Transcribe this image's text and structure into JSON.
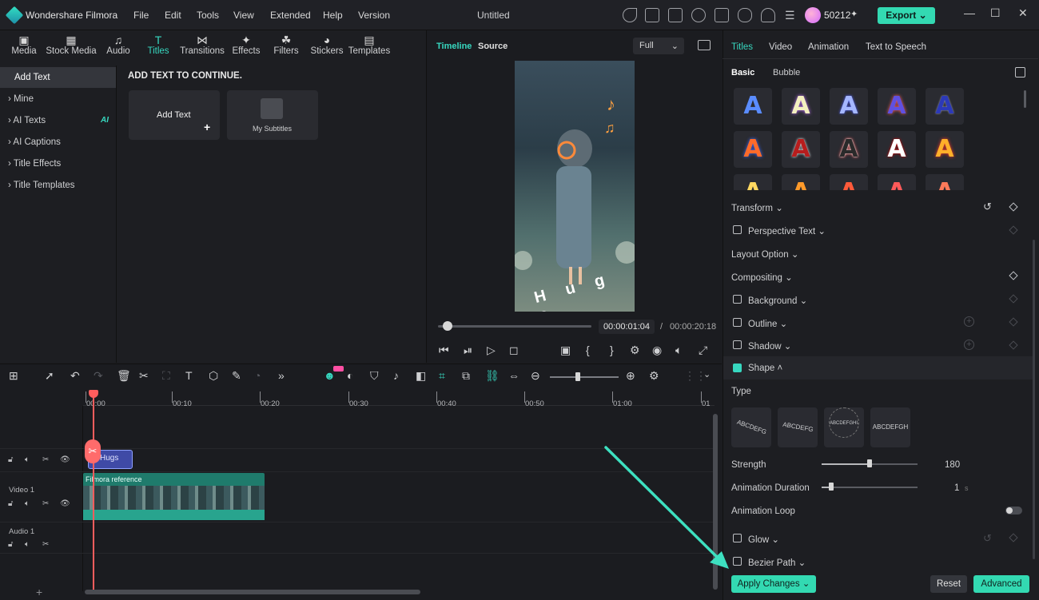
{
  "app": {
    "name": "Wondershare Filmora",
    "doc_title": "Untitled",
    "credits": "50212",
    "export_label": "Export"
  },
  "menu": [
    "File",
    "Edit",
    "Tools",
    "View",
    "Extended",
    "Help",
    "Version"
  ],
  "lib_tabs": [
    {
      "label": "Media",
      "glyph": "▣"
    },
    {
      "label": "Stock Media",
      "glyph": "▦"
    },
    {
      "label": "Audio",
      "glyph": "♫"
    },
    {
      "label": "Titles",
      "glyph": "T"
    },
    {
      "label": "Transitions",
      "glyph": "⋈"
    },
    {
      "label": "Effects",
      "glyph": "✦"
    },
    {
      "label": "Filters",
      "glyph": "☘"
    },
    {
      "label": "Stickers",
      "glyph": "◕"
    },
    {
      "label": "Templates",
      "glyph": "▤"
    }
  ],
  "sidebar": [
    "Add Text",
    "Mine",
    "AI Texts",
    "AI Captions",
    "Title Effects",
    "Title Templates"
  ],
  "ai_badge": "AI",
  "content": {
    "heading": "ADD TEXT TO CONTINUE.",
    "add_text": "Add Text",
    "my_subtitles": "My Subtitles"
  },
  "preview": {
    "tab_timeline": "Timeline",
    "tab_source": "Source",
    "quality": "Full",
    "current_time": "00:00:01:04",
    "separator": "/",
    "total_time": "00:00:20:18",
    "overlay_text": "H u g s",
    "progress": 0.06
  },
  "right_tabs": [
    "Titles",
    "Video",
    "Animation",
    "Text to Speech"
  ],
  "sub_tabs": [
    "Basic",
    "Bubble"
  ],
  "props": {
    "transform": "Transform",
    "perspective": "Perspective Text",
    "layout": "Layout Option",
    "compositing": "Compositing",
    "background": "Background",
    "outline": "Outline",
    "shadow": "Shadow",
    "shape": "Shape",
    "type": "Type",
    "strength": "Strength",
    "strength_val": "180",
    "strength_level": 0.5,
    "anim_duration": "Animation Duration",
    "anim_duration_val": "1",
    "anim_duration_unit": "s",
    "anim_duration_level": 0.1,
    "anim_loop": "Animation Loop",
    "glow": "Glow",
    "bezier": "Bezier Path"
  },
  "shape_types": [
    "ABCDEFG",
    "ABCDEFG",
    "ABCDEFGHIJKLMN",
    "ABCDEFGH"
  ],
  "buttons": {
    "apply": "Apply Changes",
    "reset": "Reset",
    "advanced": "Advanced"
  },
  "timeline": {
    "ticks": [
      "00:00",
      "00:10",
      "00:20",
      "00:30",
      "00:40",
      "00:50",
      "01:00",
      "01"
    ],
    "tracks": [
      "Video 1",
      "Audio 1"
    ],
    "text_clip": "Hugs",
    "video_clip": "Filmora reference"
  },
  "colors": {
    "accent": "#33d9b2",
    "playhead": "#ff5d5d",
    "text_clip": "#3f4aa6"
  }
}
